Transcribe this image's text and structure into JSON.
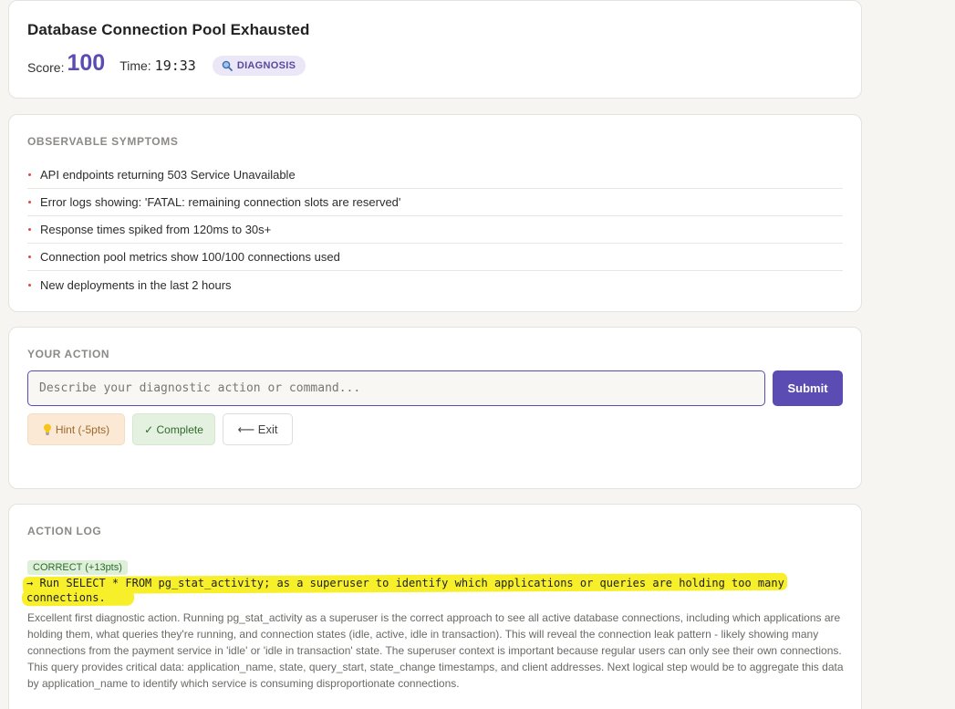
{
  "header": {
    "title": "Database Connection Pool Exhausted",
    "score_label": "Score:",
    "score_value": "100",
    "time_label": "Time:",
    "time_value": "19:33",
    "phase_badge": "DIAGNOSIS",
    "phase_icon": "magnifier-icon"
  },
  "symptoms": {
    "heading": "OBSERVABLE SYMPTOMS",
    "items": [
      "API endpoints returning 503 Service Unavailable",
      "Error logs showing: 'FATAL: remaining connection slots are reserved'",
      "Response times spiked from 120ms to 30s+",
      "Connection pool metrics show 100/100 connections used",
      "New deployments in the last 2 hours"
    ]
  },
  "action": {
    "heading": "YOUR ACTION",
    "input_value": "",
    "placeholder": "Describe your diagnostic action or command...",
    "submit_label": "Submit",
    "hint_label": "Hint (-5pts)",
    "hint_icon": "lightbulb-icon",
    "complete_label": "✓ Complete",
    "exit_label": "⟵ Exit"
  },
  "log": {
    "heading": "ACTION LOG",
    "entries": [
      {
        "badge": "CORRECT (+13pts)",
        "command": "→ Run SELECT * FROM pg_stat_activity; as a superuser to identify which applications or queries are holding too many connections.",
        "feedback": "Excellent first diagnostic action. Running pg_stat_activity as a superuser is the correct approach to see all active database connections, including which applications are holding them, what queries they're running, and connection states (idle, active, idle in transaction). This will reveal the connection leak pattern - likely showing many connections from the payment service in 'idle' or 'idle in transaction' state. The superuser context is important because regular users can only see their own connections. This query provides critical data: application_name, state, query_start, state_change timestamps, and client addresses. Next logical step would be to aggregate this data by application_name to identify which service is consuming disproportionate connections."
      }
    ]
  },
  "colors": {
    "accent": "#5a4cb3",
    "bullet": "#e0483b",
    "highlight": "#f7ef2a",
    "background": "#f6f5f2"
  }
}
